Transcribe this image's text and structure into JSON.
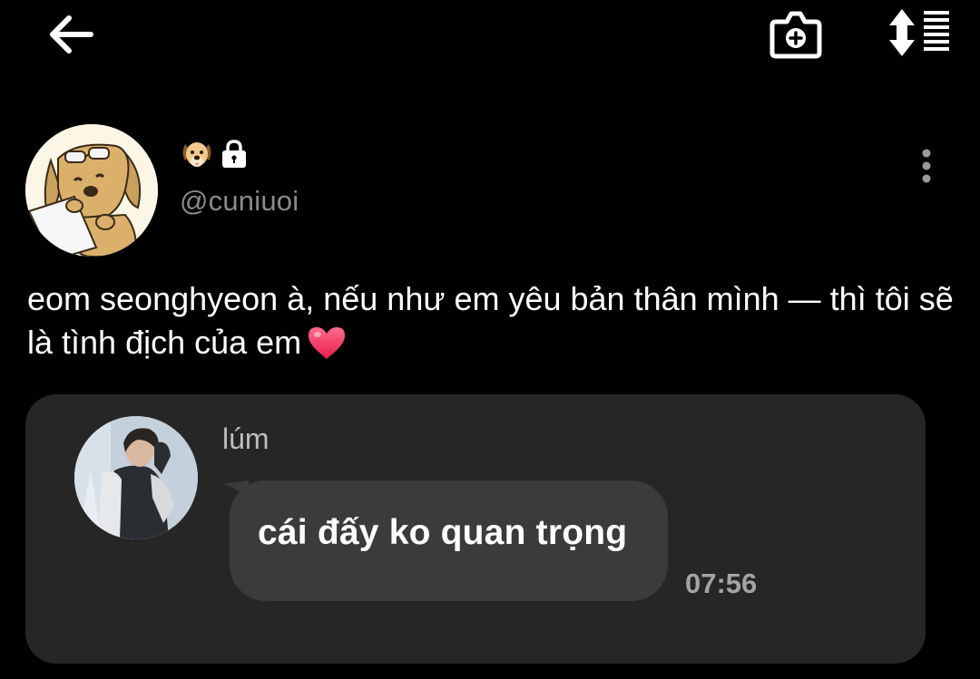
{
  "header": {
    "back_icon": "arrow-left-icon",
    "camera_icon": "camera-add-icon",
    "sort_icon": "sort-list-icon"
  },
  "profile": {
    "name_emoji": "🐶",
    "lock_icon": "lock-icon",
    "handle": "@cuniuoi",
    "more_icon": "vertical-dots-icon"
  },
  "post": {
    "caption": "eom seonghyeon à, nếu như em yêu bản thân mình — thì tôi sẽ là tình địch của em",
    "caption_emoji": "heart-icon"
  },
  "quoted_message": {
    "sender": "lúm",
    "text": "cái đấy ko quan trọng",
    "time": "07:56"
  },
  "colors": {
    "background": "#000000",
    "card": "#262626",
    "bubble": "#3b3b3b",
    "handle_text": "#8a8a8a",
    "heart": "#ff3b6b"
  }
}
